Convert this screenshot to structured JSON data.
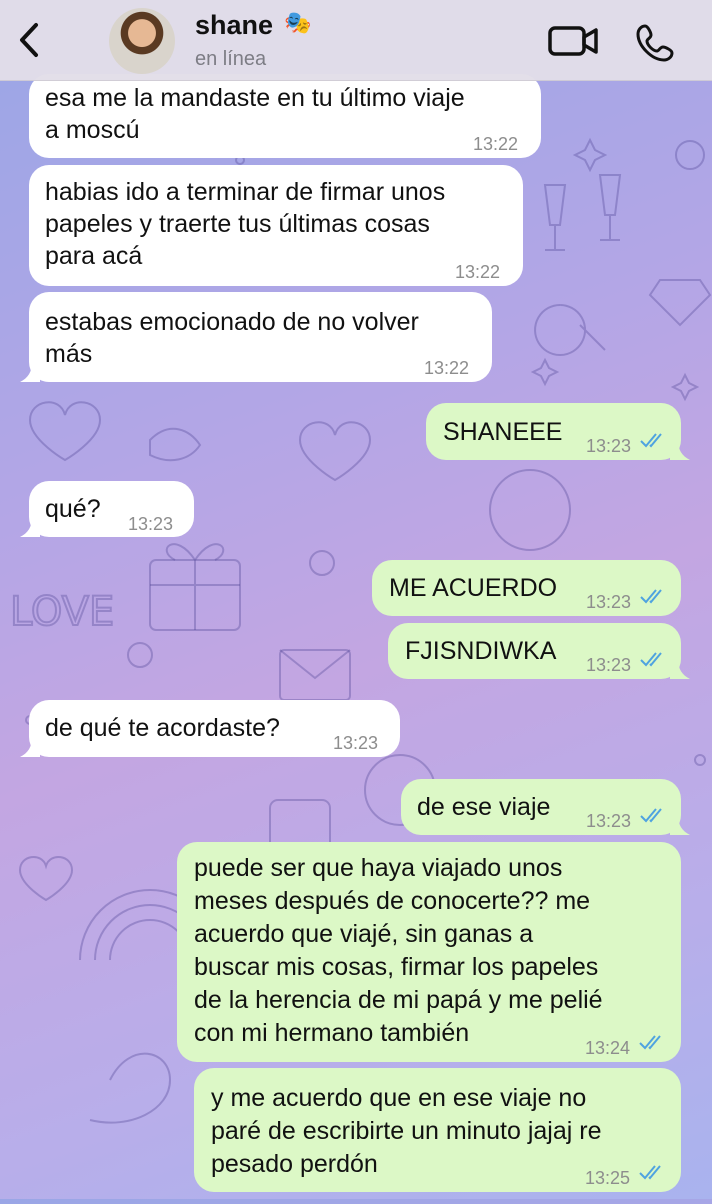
{
  "header": {
    "back_icon": "chevron-left-icon",
    "name": "shane",
    "name_emoji": "🎭",
    "status": "en línea",
    "video_icon": "video-camera-icon",
    "call_icon": "phone-icon"
  },
  "colors": {
    "incoming": "#ffffff",
    "outgoing": "#dcf8c6",
    "ticks": "#4fa3e0"
  },
  "messages": [
    {
      "dir": "in",
      "lines": [
        "esa me la mandaste en tu último viaje",
        "a moscú"
      ],
      "time": "13:22"
    },
    {
      "dir": "in",
      "lines": [
        "habias ido a terminar de firmar unos",
        "papeles y traerte tus últimas cosas",
        "para acá"
      ],
      "time": "13:22"
    },
    {
      "dir": "in",
      "lines": [
        "estabas emocionado de no volver",
        "más"
      ],
      "time": "13:22"
    },
    {
      "dir": "out",
      "lines": [
        "SHANEEE"
      ],
      "time": "13:23"
    },
    {
      "dir": "in",
      "lines": [
        "qué?"
      ],
      "time": "13:23"
    },
    {
      "dir": "out",
      "lines": [
        "ME ACUERDO"
      ],
      "time": "13:23"
    },
    {
      "dir": "out",
      "lines": [
        "FJISNDIWKA"
      ],
      "time": "13:23"
    },
    {
      "dir": "in",
      "lines": [
        "de qué te acordaste?"
      ],
      "time": "13:23"
    },
    {
      "dir": "out",
      "lines": [
        "de ese viaje"
      ],
      "time": "13:23"
    },
    {
      "dir": "out",
      "lines": [
        "puede ser que haya viajado unos",
        "meses después de conocerte?? me",
        "acuerdo que viajé, sin ganas a",
        "buscar mis cosas, firmar los papeles",
        "de la herencia de mi papá y me pelié",
        "con mi hermano también"
      ],
      "time": "13:24"
    },
    {
      "dir": "out",
      "lines": [
        "y me acuerdo que en ese viaje no",
        "paré de escribirte un minuto jajaj re",
        "pesado perdón"
      ],
      "time": "13:25"
    }
  ]
}
